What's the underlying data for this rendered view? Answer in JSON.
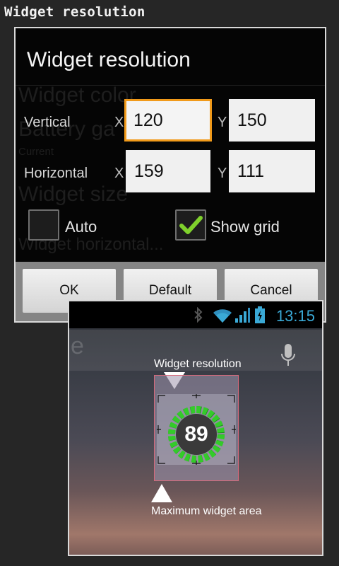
{
  "caption": "Widget resolution",
  "dialog": {
    "title": "Widget resolution",
    "background_ghosts": [
      "Widget color",
      "Battery ga",
      "Current",
      "Widget size",
      "Widget horizontal..."
    ],
    "vertical": {
      "label": "Vertical",
      "x_label": "X",
      "x_value": "120",
      "y_label": "Y",
      "y_value": "150"
    },
    "horizontal": {
      "label": "Horizontal",
      "x_label": "X",
      "x_value": "159",
      "y_label": "Y",
      "y_value": "111"
    },
    "auto": {
      "label": "Auto",
      "checked": false
    },
    "show_grid": {
      "label": "Show grid",
      "checked": true
    },
    "buttons": {
      "ok": "OK",
      "default": "Default",
      "cancel": "Cancel"
    },
    "accent_color": "#f19a1a"
  },
  "home": {
    "status_time": "13:15",
    "search_ghost": "e",
    "widget_resolution_label": "Widget resolution",
    "maximum_area_label": "Maximum widget area",
    "battery_value": "89",
    "icons": [
      "bluetooth-icon",
      "wifi-icon",
      "signal-icon",
      "battery-icon",
      "mic-icon"
    ]
  }
}
